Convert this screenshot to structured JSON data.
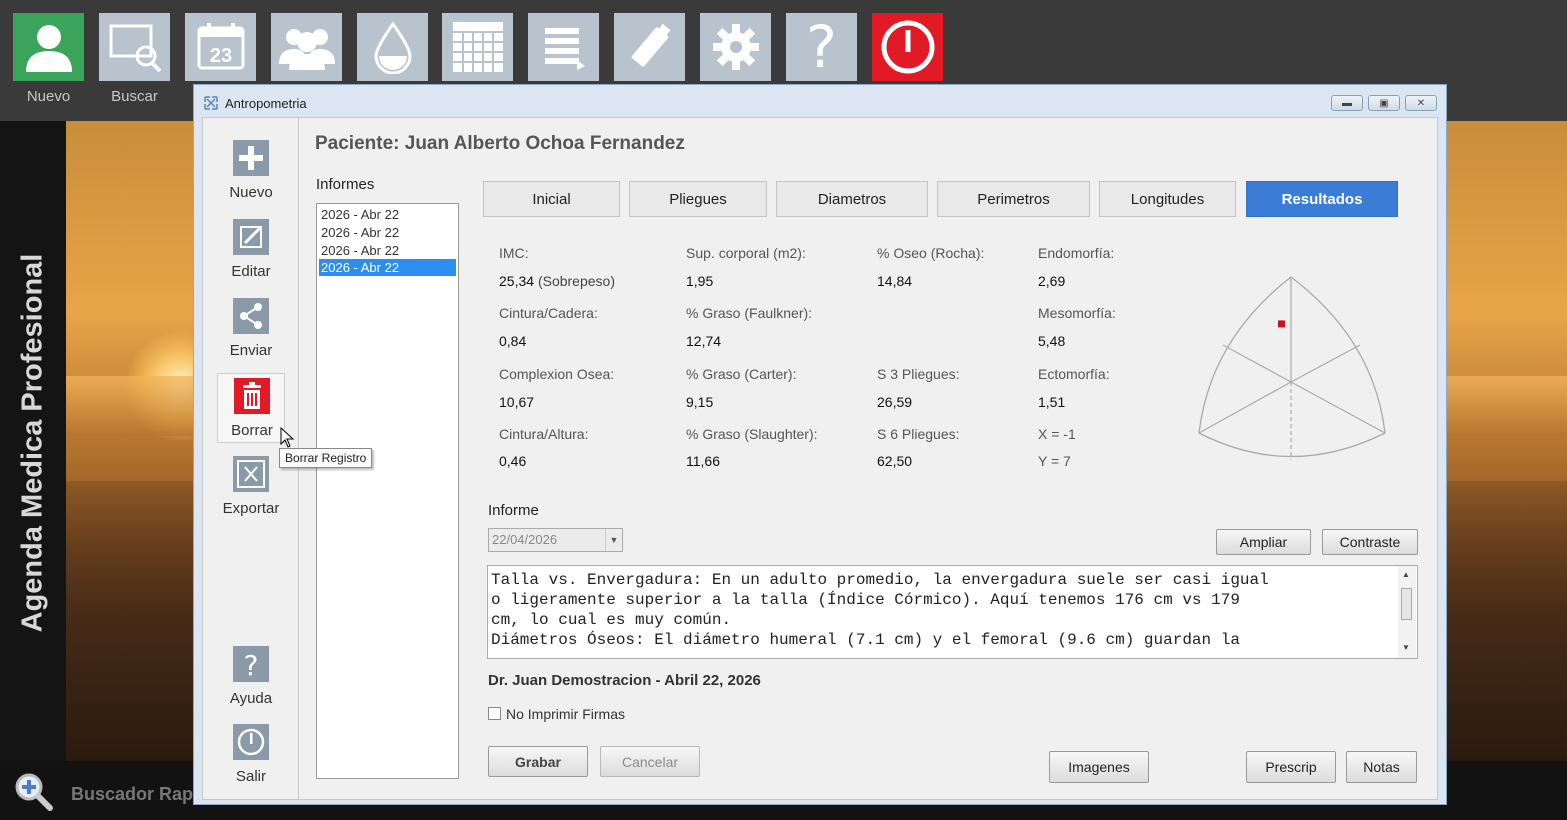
{
  "toolbar": {
    "items": [
      {
        "icon": "user-icon",
        "label": "Nuevo"
      },
      {
        "icon": "search-screen-icon",
        "label": "Buscar"
      },
      {
        "icon": "calendar-icon",
        "label": ""
      },
      {
        "icon": "users-icon",
        "label": ""
      },
      {
        "icon": "drop-icon",
        "label": ""
      },
      {
        "icon": "grid-icon",
        "label": ""
      },
      {
        "icon": "list-icon",
        "label": ""
      },
      {
        "icon": "usb-icon",
        "label": ""
      },
      {
        "icon": "gear-icon",
        "label": ""
      },
      {
        "icon": "help-icon",
        "label": ""
      },
      {
        "icon": "power-icon",
        "label": ""
      }
    ],
    "calendar_day": "23"
  },
  "app_title": "Agenda Medica Profesional",
  "quick_search": "Buscador Rap",
  "window": {
    "title": "Antropometria",
    "sidebar": [
      "Nuevo",
      "Editar",
      "Enviar",
      "Borrar",
      "Exportar",
      "Ayuda",
      "Salir"
    ],
    "tooltip": "Borrar Registro",
    "patient": "Paciente: Juan Alberto Ochoa Fernandez",
    "informes_label": "Informes",
    "informes": [
      "2026 - Abr 22",
      "2026 - Abr 22",
      "2026 - Abr 22",
      "2026 - Abr 22"
    ],
    "selected_informe": 3,
    "tabs": [
      "Inicial",
      "Pliegues",
      "Diametros",
      "Perimetros",
      "Longitudes",
      "Resultados"
    ],
    "active_tab": "Resultados",
    "results": {
      "imc": {
        "label": "IMC:",
        "value": "25,34",
        "note": "(Sobrepeso)"
      },
      "sup": {
        "label": "Sup. corporal (m2):",
        "value": "1,95"
      },
      "oseo": {
        "label": "% Oseo (Rocha):",
        "value": "14,84"
      },
      "endo": {
        "label": "Endomorfía:",
        "value": "2,69"
      },
      "cintura_cadera": {
        "label": "Cintura/Cadera:",
        "value": "0,84"
      },
      "graso_faulkner": {
        "label": "% Graso (Faulkner):",
        "value": "12,74"
      },
      "meso": {
        "label": "Mesomorfía:",
        "value": "5,48"
      },
      "complexion": {
        "label": "Complexion Osea:",
        "value": "10,67"
      },
      "graso_carter": {
        "label": "% Graso (Carter):",
        "value": "9,15"
      },
      "s3": {
        "label": "S 3 Pliegues:",
        "value": "26,59"
      },
      "ecto": {
        "label": "Ectomorfía:",
        "value": "1,51"
      },
      "cintura_altura": {
        "label": "Cintura/Altura:",
        "value": "0,46"
      },
      "graso_slaughter": {
        "label": "% Graso (Slaughter):",
        "value": "11,66"
      },
      "s6": {
        "label": "S 6 Pliegues:",
        "value": "62,50"
      },
      "x": "X = -1",
      "y": "Y = 7"
    },
    "somatochart": {
      "x": -1,
      "y": 7,
      "point_color": "#c8141e"
    },
    "informe_label": "Informe",
    "informe_date": "22/04/2026",
    "ampliar": "Ampliar",
    "contraste": "Contraste",
    "informe_text": "Talla vs. Envergadura: En un adulto promedio, la envergadura suele ser casi igual\no ligeramente superior a la talla (Índice Córmico). Aquí tenemos 176 cm vs 179\ncm, lo cual es muy común.\nDiámetros Óseos: El diámetro humeral (7.1 cm) y el femoral (9.6 cm) guardan la",
    "signer": "Dr. Juan Demostracion - Abril 22, 2026",
    "no_imprimir": "No Imprimir Firmas",
    "grabar": "Grabar",
    "cancelar": "Cancelar",
    "imagenes": "Imagenes",
    "prescrip": "Prescrip",
    "notas": "Notas"
  },
  "colors": {
    "accent": "#3a7cd6",
    "toolbar_bg": "#3a3a3a",
    "tile": "#b9c3cd",
    "green": "#3aa55a",
    "red": "#e11a26"
  }
}
